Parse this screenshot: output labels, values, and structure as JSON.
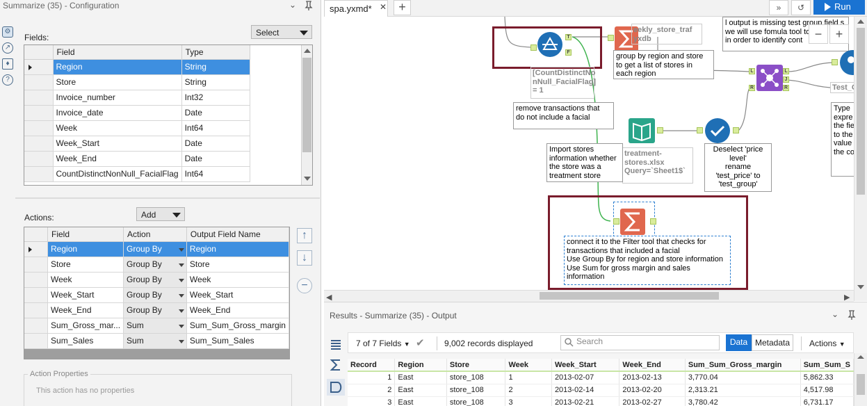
{
  "config": {
    "title": "Summarize (35) - Configuration",
    "fields_label": "Fields:",
    "select_label": "Select",
    "fields_columns": [
      "Field",
      "Type"
    ],
    "fields": [
      {
        "field": "Region",
        "type": "String"
      },
      {
        "field": "Store",
        "type": "String"
      },
      {
        "field": "Invoice_number",
        "type": "Int32"
      },
      {
        "field": "Invoice_date",
        "type": "Date"
      },
      {
        "field": "Week",
        "type": "Int64"
      },
      {
        "field": "Week_Start",
        "type": "Date"
      },
      {
        "field": "Week_End",
        "type": "Date"
      },
      {
        "field": "CountDistinctNonNull_FacialFlag",
        "type": "Int64"
      }
    ],
    "actions_label": "Actions:",
    "add_label": "Add",
    "actions_columns": [
      "Field",
      "Action",
      "Output Field Name"
    ],
    "actions": [
      {
        "field": "Region",
        "action": "Group By",
        "output": "Region"
      },
      {
        "field": "Store",
        "action": "Group By",
        "output": "Store"
      },
      {
        "field": "Week",
        "action": "Group By",
        "output": "Week"
      },
      {
        "field": "Week_Start",
        "action": "Group By",
        "output": "Week_Start"
      },
      {
        "field": "Week_End",
        "action": "Group By",
        "output": "Week_End"
      },
      {
        "field": "Sum_Gross_mar...",
        "action": "Sum",
        "output": "Sum_Sum_Gross_margin"
      },
      {
        "field": "Sum_Sales",
        "action": "Sum",
        "output": "Sum_Sum_Sales"
      }
    ],
    "action_properties_label": "Action Properties",
    "action_properties_msg": "This action has no properties"
  },
  "tabs": {
    "active": "spa.yxmd*",
    "run_label": "Run"
  },
  "canvas": {
    "notes": {
      "top_right": "l output is missing test group field s\nwe will use fomula tool to\nin order to identify cont",
      "weekly_label": "eekly_store_traf\nyxdb",
      "group_note": "group by region and store\nto get a list of stores in\neach region",
      "filter_expr": "[CountDistinctNo\nnNull_FacialFlag]\n= 1",
      "remove_note": "remove transactions that\ndo not include a facial",
      "import_note": "Import stores\ninformation whether\nthe store was a\ntreatment store",
      "treatment_label": "treatment-\nstores.xlsx\nQuery=`Sheet1$`",
      "deselect_note": "Deselect 'price\nlevel'\nrename\n'test_price' to\n'test_group'",
      "test_label": "Test_G",
      "type_note": "Type\nexpre\nthe fie\nto the\nvalue\nthe co",
      "summarize_note": "connect it to the Filter tool that checks for\ntransactions that included a facial\nUse Group By for region and store information\nUse Sum for gross margin and sales\ninformation"
    }
  },
  "results": {
    "title": "Results - Summarize (35) - Output",
    "fields_count": "7 of 7 Fields",
    "records": "9,002 records displayed",
    "search_placeholder": "Search",
    "data_btn": "Data",
    "metadata_btn": "Metadata",
    "actions_btn": "Actions",
    "columns": [
      "Record",
      "Region",
      "Store",
      "Week",
      "Week_Start",
      "Week_End",
      "Sum_Sum_Gross_margin",
      "Sum_Sum_S"
    ],
    "rows": [
      [
        "1",
        "East",
        "store_108",
        "1",
        "2013-02-07",
        "2013-02-13",
        "3,770.04",
        "5,862.33"
      ],
      [
        "2",
        "East",
        "store_108",
        "2",
        "2013-02-14",
        "2013-02-20",
        "2,313.21",
        "4,517.98"
      ],
      [
        "3",
        "East",
        "store_108",
        "3",
        "2013-02-21",
        "2013-02-27",
        "3,780.42",
        "6,731.17"
      ]
    ],
    "colors": {
      "accent": "#1a73d2",
      "selection": "#3e8fe0",
      "header_border": "#7a1c2c"
    }
  }
}
